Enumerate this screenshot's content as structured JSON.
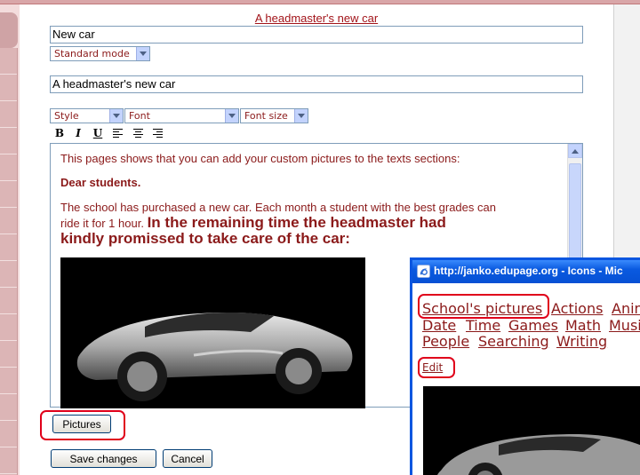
{
  "main": {
    "title_link": "A headmaster's new car",
    "name_value": "New car",
    "mode_select": "Standard mode",
    "heading_value": "A headmaster's new car"
  },
  "toolbar": {
    "style_select": "Style",
    "font_select": "Font",
    "size_select": "Font size",
    "bold_label": "B",
    "italic_label": "I",
    "underline_label": "U"
  },
  "editor": {
    "line1": "This pages shows that you can add your custom pictures to the texts sections:",
    "line2": "Dear students.",
    "line3a": "The school has purchased a new car. Each month a student with the best grades can",
    "line3b": "ride it for 1 hour.",
    "bold_part": "In the remaining time the headmaster had",
    "bold_part2": "kindly promissed to take care of the car:"
  },
  "buttons": {
    "pictures": "Pictures",
    "save": "Save changes",
    "cancel": "Cancel"
  },
  "popup": {
    "title": "http://janko.edupage.org - Icons - Mic",
    "links_row1": [
      "School's pictures",
      "Actions",
      "Anim"
    ],
    "links_row2": [
      "Date",
      "Time",
      "Games",
      "Math",
      "Musi"
    ],
    "links_row3": [
      "People",
      "Searching",
      "Writing"
    ],
    "edit_link": "Edit"
  },
  "colors": {
    "link": "#8b1a1a",
    "highlight": "#e0001a",
    "titlebar": "#0a56e0"
  }
}
